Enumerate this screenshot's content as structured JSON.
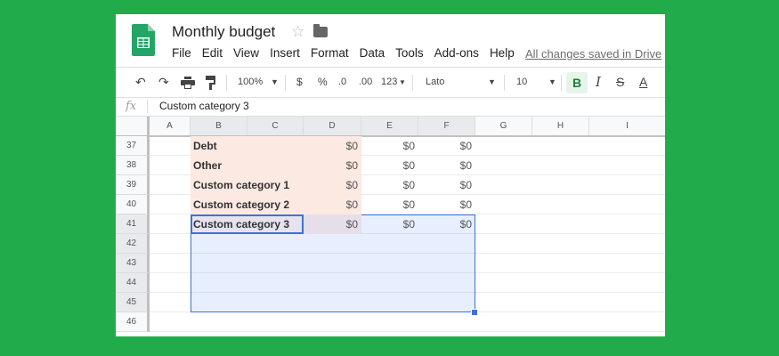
{
  "doc": {
    "title": "Monthly budget",
    "save_status": "All changes saved in Drive"
  },
  "menu": [
    "File",
    "Edit",
    "View",
    "Insert",
    "Format",
    "Data",
    "Tools",
    "Add-ons",
    "Help"
  ],
  "toolbar": {
    "zoom": "100%",
    "currency": "$",
    "percent": "%",
    "dec_less": ".0",
    "dec_more": ".00",
    "more_formats": "123",
    "font": "Lato",
    "font_size": "10",
    "bold": "B",
    "italic": "I",
    "strike": "S",
    "text_color": "A"
  },
  "formula_bar": {
    "fx": "fx",
    "value": "Custom category 3"
  },
  "columns": [
    "A",
    "B",
    "C",
    "D",
    "E",
    "F",
    "G",
    "H",
    "I"
  ],
  "rows": [
    {
      "num": "37",
      "category": "Debt",
      "d": "$0",
      "e": "$0",
      "f": "$0"
    },
    {
      "num": "38",
      "category": "Other",
      "d": "$0",
      "e": "$0",
      "f": "$0"
    },
    {
      "num": "39",
      "category": "Custom category 1",
      "d": "$0",
      "e": "$0",
      "f": "$0"
    },
    {
      "num": "40",
      "category": "Custom category 2",
      "d": "$0",
      "e": "$0",
      "f": "$0"
    },
    {
      "num": "41",
      "category": "Custom category 3",
      "d": "$0",
      "e": "$0",
      "f": "$0"
    },
    {
      "num": "42"
    },
    {
      "num": "43"
    },
    {
      "num": "44"
    },
    {
      "num": "45"
    },
    {
      "num": "46"
    }
  ],
  "colors": {
    "background": "#22ab4b",
    "selection": "#3b73d6",
    "category_fill": "#fbe9e2"
  }
}
